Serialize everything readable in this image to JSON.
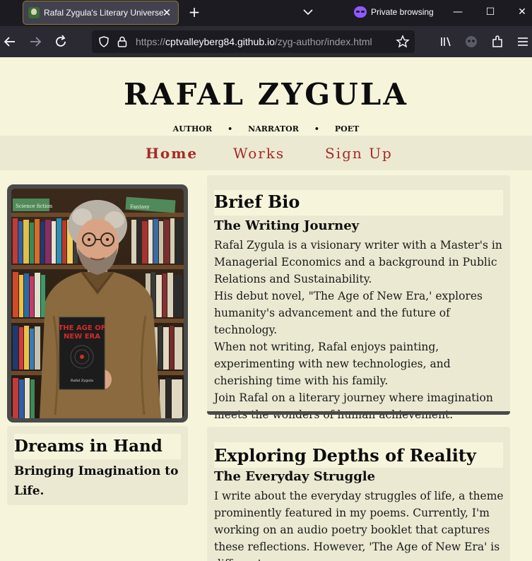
{
  "browser": {
    "tab_title": "Rafal Zygula's Literary Universe",
    "private_label": "Private browsing",
    "url_prefix": "https://",
    "url_host": "cptvalleyberg84.github.io",
    "url_path": "/zyg-author/index.html"
  },
  "site": {
    "title": "RAFAL ZYGULA",
    "tagline": [
      "AUTHOR",
      "•",
      "NARRATOR",
      "•",
      "POET"
    ],
    "nav": [
      "Home",
      "Works",
      "Sign Up"
    ],
    "accent_color": "#a52a2a",
    "background_color": "#f6f5dc"
  },
  "photo": {
    "shelf_sign_left": "Science fiction",
    "shelf_sign_right": "Fantasy",
    "book_title_line1": "THE AGE OF",
    "book_title_line2": "NEW ERA",
    "book_author": "Rafal Zygula"
  },
  "bio": {
    "heading": "Brief Bio",
    "subheading": "The Writing Journey",
    "paragraphs": [
      "Rafal Zygula is a visionary writer with a Master's in Managerial Economics and a background in Public Relations and Sustainability.",
      "His debut novel, \"The Age of New Era,' explores humanity's advancement and the future of technology.",
      "When not writing, Rafal enjoys painting, experimenting with new technologies, and cherishing time with his family.",
      "Join Rafal on a literary journey where imagination meets the wonders of human achievement."
    ]
  },
  "dreams": {
    "heading": "Dreams in Hand",
    "subheading": "Bringing Imagination to Life."
  },
  "explore": {
    "heading": "Exploring Depths of Reality",
    "subheading": "The Everyday Struggle",
    "paragraph": "I write about the everyday struggles of life, a theme prominently featured in my poems. Currently, I'm working on an audio poetry booklet that captures these reflections. However, 'The Age of New Era' is different."
  }
}
